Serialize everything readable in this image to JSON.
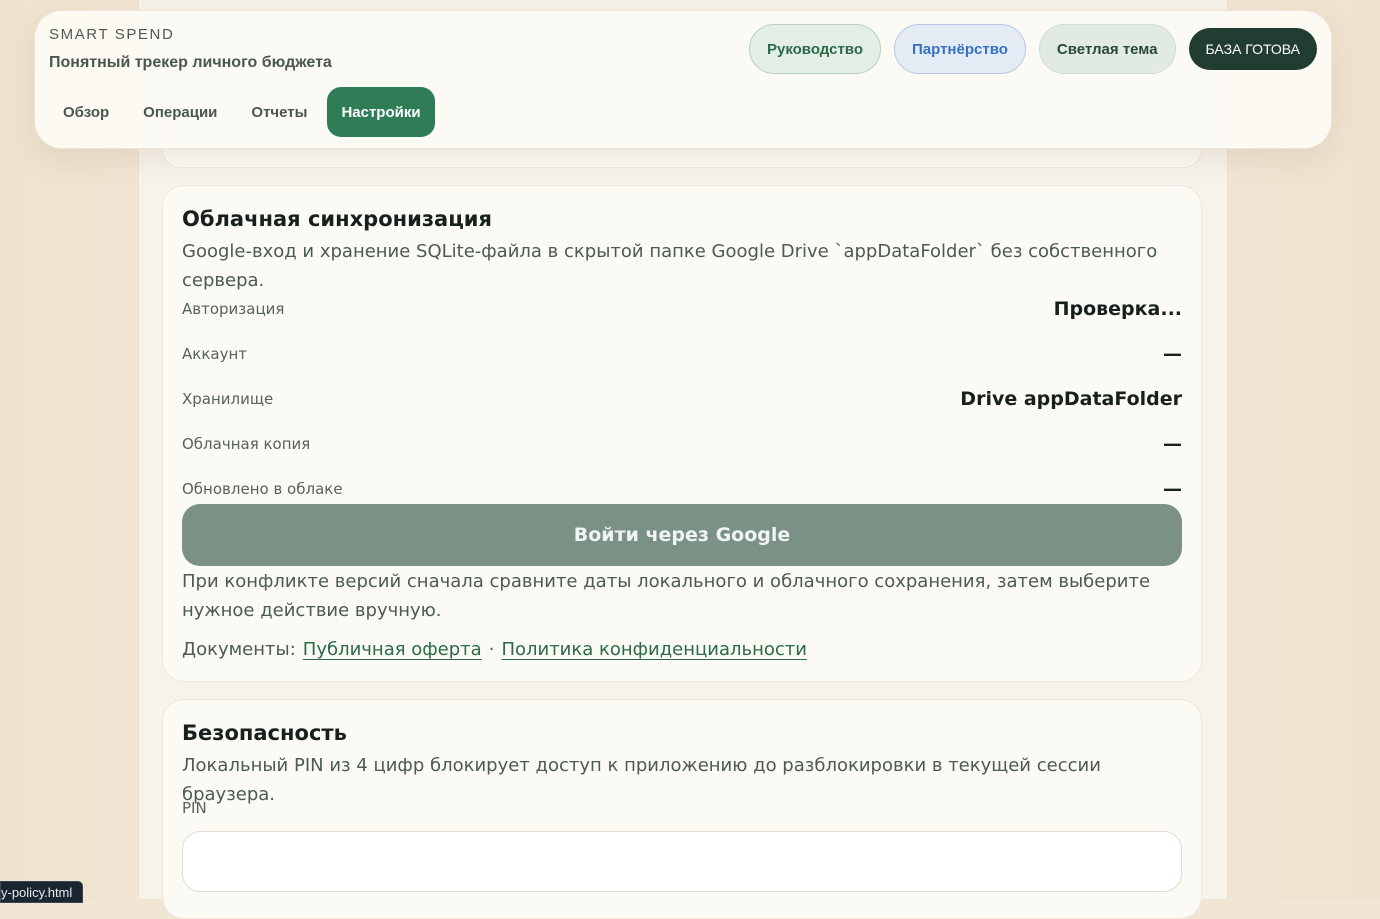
{
  "header": {
    "kicker": "SMART SPEND",
    "subtitle": "Понятный трекер личного бюджета",
    "tabs": [
      {
        "label": "Обзор",
        "active": false
      },
      {
        "label": "Операции",
        "active": false
      },
      {
        "label": "Отчеты",
        "active": false
      },
      {
        "label": "Настройки",
        "active": true
      }
    ],
    "actions": {
      "guide": "Руководство",
      "partner": "Партнёрство",
      "theme": "Светлая тема",
      "db_status": "БАЗА ГОТОВА"
    }
  },
  "sync": {
    "title": "Облачная синхронизация",
    "description": "Google-вход и хранение SQLite-файла в скрытой папке Google Drive `appDataFolder` без собственного сервера.",
    "rows": [
      {
        "label": "Авторизация",
        "value": "Проверка..."
      },
      {
        "label": "Аккаунт",
        "value": "—"
      },
      {
        "label": "Хранилище",
        "value": "Drive appDataFolder"
      },
      {
        "label": "Облачная копия",
        "value": "—"
      },
      {
        "label": "Обновлено в облаке",
        "value": "—"
      }
    ],
    "google_button": "Войти через Google",
    "conflict_note": "При конфликте версий сначала сравните даты локального и облачного сохранения, затем выберите нужное действие вручную.",
    "docs_label": "Документы:",
    "docs_separator": "·",
    "offer_link": "Публичная оферта",
    "privacy_link": "Политика конфиденциальности"
  },
  "security": {
    "title": "Безопасность",
    "description": "Локальный PIN из 4 цифр блокирует доступ к приложению до разблокировки в текущей сессии браузера.",
    "pin_label": "PIN",
    "pin_value": ""
  },
  "statusbar": {
    "url": "y-policy.html"
  },
  "colors": {
    "accent": "#2e7d57",
    "background": "#f1e6d3",
    "card": "#fcfaf5",
    "db_pill": "#213c31",
    "google_button": "#7b9186",
    "partner_text": "#3572c4"
  }
}
